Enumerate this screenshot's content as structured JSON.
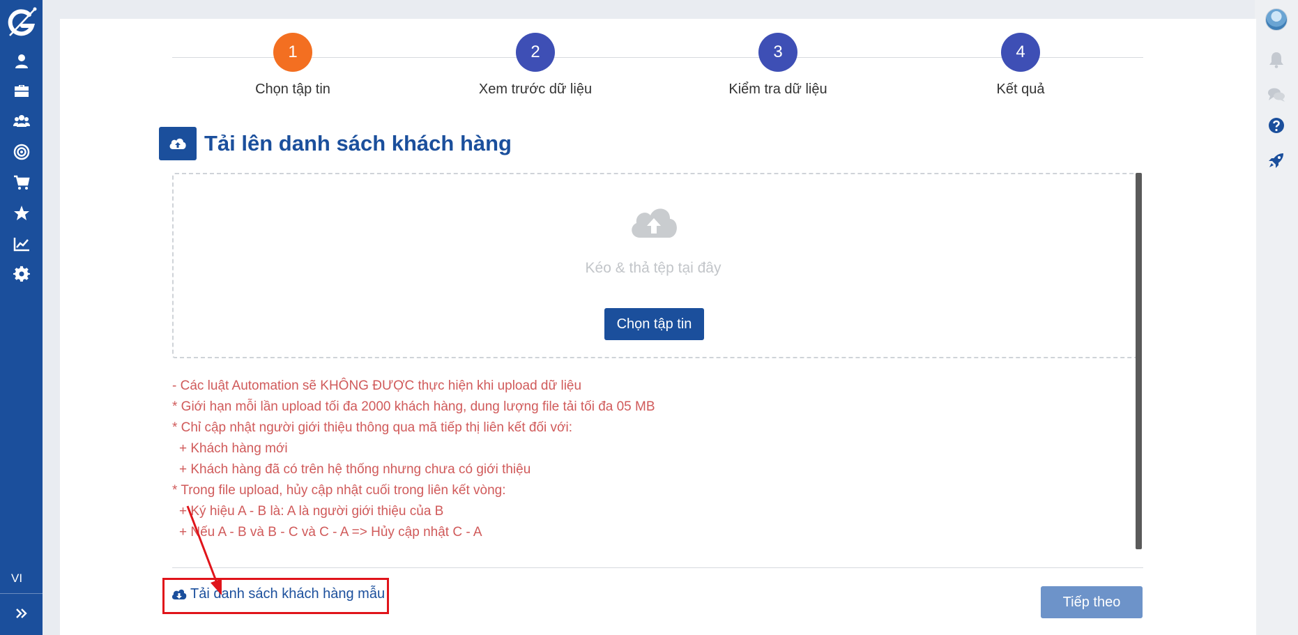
{
  "sidebar": {
    "logo_icon": "g-logo-icon",
    "items": [
      {
        "name": "user-icon"
      },
      {
        "name": "briefcase-icon"
      },
      {
        "name": "users-icon"
      },
      {
        "name": "target-icon"
      },
      {
        "name": "cart-icon"
      },
      {
        "name": "star-icon"
      },
      {
        "name": "chart-line-icon"
      },
      {
        "name": "gear-icon"
      }
    ],
    "language": "VI",
    "expand_icon": "double-chevron-right-icon"
  },
  "rightrail": {
    "items": [
      "avatar",
      "bell-icon",
      "chat-icon",
      "help-icon",
      "rocket-icon"
    ]
  },
  "stepper": {
    "steps": [
      {
        "number": "1",
        "label": "Chọn tập tin",
        "active": true
      },
      {
        "number": "2",
        "label": "Xem trước dữ liệu",
        "active": false
      },
      {
        "number": "3",
        "label": "Kiểm tra dữ liệu",
        "active": false
      },
      {
        "number": "4",
        "label": "Kết quả",
        "active": false
      }
    ]
  },
  "page": {
    "title": "Tải lên danh sách khách hàng"
  },
  "dropzone": {
    "hint": "Kéo & thả tệp tại đây",
    "button_label": "Chọn tập tin"
  },
  "notes": [
    "- Các luật Automation sẽ KHÔNG ĐƯỢC thực hiện khi upload dữ liệu",
    "* Giới hạn mỗi lần upload tối đa 2000 khách hàng, dung lượng file tải tối đa 05 MB",
    "* Chỉ cập nhật người giới thiệu thông qua mã tiếp thị liên kết đối với:",
    "+ Khách hàng mới",
    "+ Khách hàng đã có trên hệ thống nhưng chưa có giới thiệu",
    "* Trong file upload, hủy cập nhật cuối trong liên kết vòng:",
    "+ Ký hiệu A - B là: A là người giới thiệu của B",
    "+ Nếu A - B và B - C và C - A => Hủy cập nhật C - A"
  ],
  "footer": {
    "download_label": "Tải danh sách khách hàng mẫu",
    "next_label": "Tiếp theo"
  },
  "colors": {
    "primary": "#1b4f9c",
    "step_active": "#f36f21",
    "step_inactive": "#3e4fb5",
    "note_text": "#d05a5a",
    "highlight": "#e0141a"
  }
}
